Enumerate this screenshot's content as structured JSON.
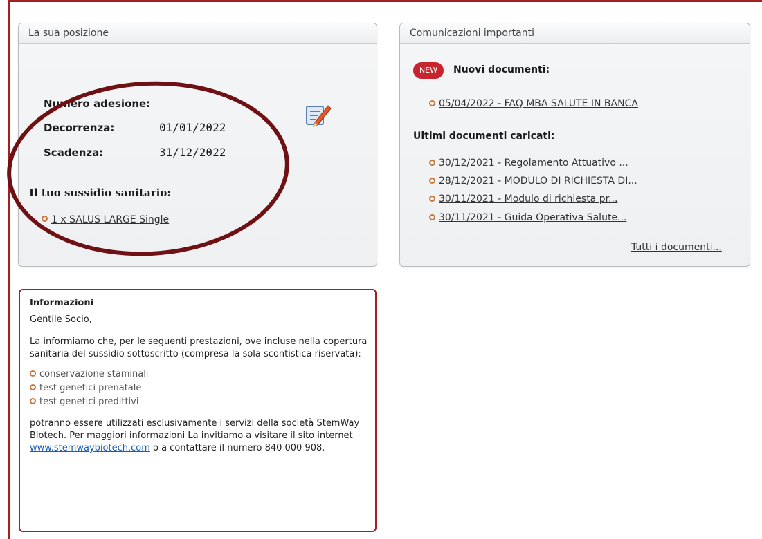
{
  "position_panel": {
    "title": "La sua posizione",
    "membership_number_label": "Numero adesione:",
    "membership_number_value": "",
    "start_label": "Decorrenza:",
    "start_value": "01/01/2022",
    "end_label": "Scadenza:",
    "end_value": "31/12/2022",
    "subsidy_label": "Il tuo sussidio sanitario:",
    "subsidy_item": "1 x SALUS LARGE Single",
    "edit_icon": "edit-document-icon"
  },
  "communications_panel": {
    "title": "Comunicazioni importanti",
    "new_badge": "NEW",
    "new_docs_label": "Nuovi documenti:",
    "new_docs": [
      "05/04/2022 - FAQ MBA SALUTE IN BANCA"
    ],
    "recent_docs_label": "Ultimi documenti caricati:",
    "recent_docs": [
      "30/12/2021 - Regolamento Attuativo ...",
      "28/12/2021 - MODULO DI RICHIESTA DI...",
      "30/11/2021 - Modulo di richiesta pr...",
      "30/11/2021 - Guida Operativa Salute..."
    ],
    "all_docs_link": "Tutti i documenti..."
  },
  "info_box": {
    "title": "Informazioni",
    "greeting": "Gentile Socio,",
    "intro": "La informiamo che, per le seguenti prestazioni, ove incluse nella copertura sanitaria del sussidio sottoscritto (compresa la sola scontistica riservata):",
    "services": [
      "conservazione staminali",
      "test genetici prenatale",
      "test genetici predittivi"
    ],
    "outro_before_link": "potranno essere utilizzati esclusivamente i servizi della società StemWay Biotech. Per maggiori informazioni La invitiamo a visitare il sito internet ",
    "link_text": "www.stemwaybiotech.com",
    "outro_after_link": " o a contattare il numero 840 000 908."
  },
  "colors": {
    "accent": "#a31f24",
    "annotation_ellipse": "#6e1014",
    "bullet": "#c8763b",
    "link_blue": "#1a5fb4",
    "badge": "#c8242d"
  }
}
